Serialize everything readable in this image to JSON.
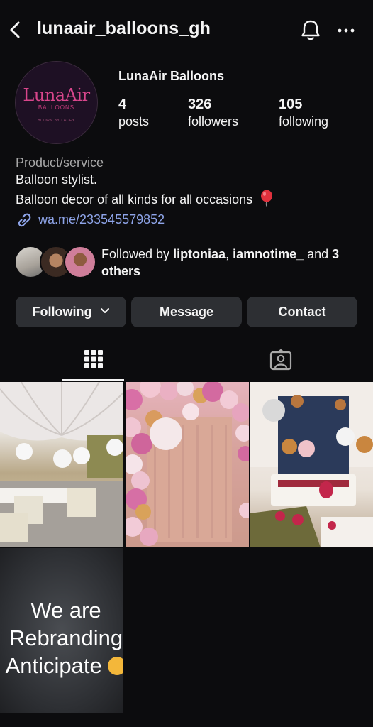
{
  "header": {
    "username": "lunaair_balloons_gh"
  },
  "profile": {
    "logo": {
      "name": "LunaAir",
      "sub": "BALLOONS",
      "tagline": "BLOWN BY LACEY"
    },
    "display_name": "LunaAir Balloons",
    "stats": {
      "posts": {
        "value": "4",
        "label": "posts"
      },
      "followers": {
        "value": "326",
        "label": "followers"
      },
      "following": {
        "value": "105",
        "label": "following"
      }
    },
    "category": "Product/service",
    "bio_line1": "Balloon stylist.",
    "bio_line2": "Balloon decor of all kinds for all occasions",
    "link": "wa.me/233545579852",
    "followed_by": {
      "prefix": "Followed by ",
      "user1": "liptoniaa",
      "sep": ", ",
      "user2": "iamnotime_",
      "and": " and ",
      "others": "3 others"
    }
  },
  "buttons": {
    "following": "Following",
    "message": "Message",
    "contact": "Contact"
  },
  "tabs": [
    {
      "name": "posts-grid",
      "icon": "grid-icon",
      "active": true
    },
    {
      "name": "tagged",
      "icon": "tagged-person-icon",
      "active": false
    }
  ],
  "posts": {
    "post4_text_line1": "We are",
    "post4_text_line2": "Rebranding",
    "post4_text_line3": "Anticipate"
  },
  "colors": {
    "background": "#0c0c0e",
    "button": "#2d2f33",
    "link": "#8ea4e8",
    "muted": "#a8a8a8",
    "brand_pink": "#d9468c"
  }
}
